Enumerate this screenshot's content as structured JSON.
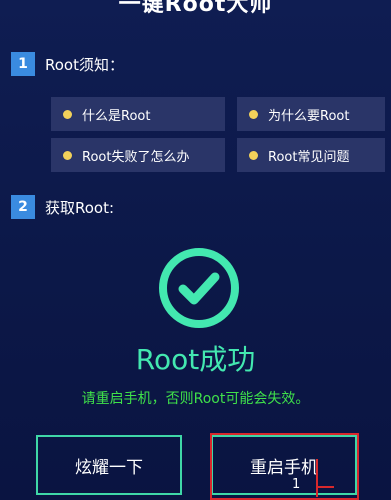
{
  "header": {
    "title": "一键Root大师"
  },
  "section1": {
    "number": "1",
    "label": "Root须知："
  },
  "cards": [
    {
      "label": "什么是Root"
    },
    {
      "label": "为什么要Root"
    },
    {
      "label": "Root失败了怎么办"
    },
    {
      "label": "Root常见问题"
    }
  ],
  "section2": {
    "number": "2",
    "label": "获取Root:"
  },
  "status": {
    "title": "Root成功",
    "message": "请重启手机，否则Root可能会失效。",
    "icon": "check-circle-icon"
  },
  "buttons": {
    "share_label": "炫耀一下",
    "restart_label": "重启手机"
  },
  "annotation": {
    "mark": "1"
  },
  "colors": {
    "accent": "#43e8b0",
    "message": "#3fe04a",
    "badge": "#3a8be0",
    "dot": "#f2d15a",
    "highlight": "#d8282c"
  }
}
